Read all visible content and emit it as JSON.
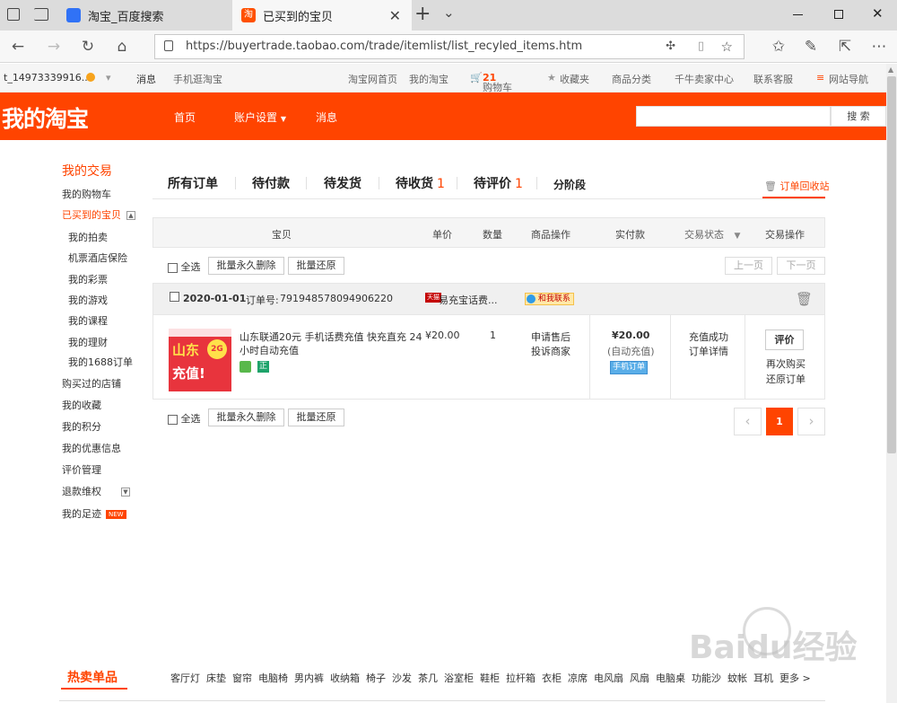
{
  "browser": {
    "tabs": [
      {
        "title": "淘宝_百度搜索",
        "icon": "baidu-paw"
      },
      {
        "title": "已买到的宝贝",
        "icon": "taobao"
      }
    ],
    "new_tab": "+",
    "url": "https://buyertrade.taobao.com/trade/itemlist/list_recyled_items.htm"
  },
  "site_nav": {
    "user": "t_14973339916...",
    "messages": "消息",
    "mobile": "手机逛淘宝",
    "home": "淘宝网首页",
    "my_taobao": "我的淘宝",
    "cart": "购物车",
    "cart_count": "21",
    "favorites": "收藏夹",
    "categories": "商品分类",
    "seller_center": "千牛卖家中心",
    "service": "联系客服",
    "site_map": "网站导航"
  },
  "header": {
    "logo": "我的淘宝",
    "nav": [
      "首页",
      "账户设置",
      "消息"
    ],
    "search_button": "搜 索",
    "search_value": ""
  },
  "sidebar": {
    "title": "我的交易",
    "items": [
      {
        "label": "我的购物车"
      },
      {
        "label": "已买到的宝贝",
        "active": true
      },
      {
        "label": "我的拍卖",
        "sub": true
      },
      {
        "label": "机票酒店保险",
        "sub": true
      },
      {
        "label": "我的彩票",
        "sub": true
      },
      {
        "label": "我的游戏",
        "sub": true
      },
      {
        "label": "我的课程",
        "sub": true
      },
      {
        "label": "我的理财",
        "sub": true
      },
      {
        "label": "我的1688订单",
        "sub": true
      },
      {
        "label": "购买过的店铺"
      },
      {
        "label": "我的收藏"
      },
      {
        "label": "我的积分"
      },
      {
        "label": "我的优惠信息"
      },
      {
        "label": "评价管理"
      },
      {
        "label": "退款维权"
      },
      {
        "label": "我的足迹",
        "badge": "NEW"
      }
    ]
  },
  "order_tabs": [
    {
      "label": "所有订单",
      "count": ""
    },
    {
      "label": "待付款",
      "count": ""
    },
    {
      "label": "待发货",
      "count": ""
    },
    {
      "label": "待收货",
      "count": "1"
    },
    {
      "label": "待评价",
      "count": "1"
    },
    {
      "label": "分阶段",
      "count": ""
    }
  ],
  "recycle_bin": "订单回收站",
  "table_headers": [
    "宝贝",
    "单价",
    "数量",
    "商品操作",
    "实付款",
    "交易状态",
    "交易操作"
  ],
  "bulk": {
    "select_all": "全选",
    "delete_forever": "批量永久删除",
    "restore": "批量还原",
    "prev": "上一页",
    "next": "下一页"
  },
  "order": {
    "date": "2020-01-01",
    "order_no_label": "订单号:",
    "order_no": "791948578094906220",
    "shop_badge": "天猫",
    "shop": "易充宝话费...",
    "contact": "和我联系",
    "thumb_text_1": "山东",
    "thumb_text_2": "充值!",
    "thumb_badge": "2G",
    "title_line1": "山东联通20元 手机话费充值 快充直充 24",
    "title_line2": "小时自动充值",
    "tag_zheng": "正",
    "price": "¥20.00",
    "qty": "1",
    "op1": "申请售后",
    "op2": "投诉商家",
    "paid": "¥20.00",
    "paid_note": "(自动充值)",
    "mobile_order": "手机订单",
    "status": "充值成功",
    "detail": "订单详情",
    "review": "评价",
    "rebuy": "再次购买",
    "restore": "还原订单"
  },
  "pager": {
    "prev": "‹",
    "current": "1",
    "next": "›"
  },
  "hot": {
    "title": "热卖单品",
    "items": [
      "客厅灯",
      "床垫",
      "窗帘",
      "电脑椅",
      "男内裤",
      "收纳箱",
      "椅子",
      "沙发",
      "茶几",
      "浴室柜",
      "鞋柜",
      "拉杆箱",
      "衣柜",
      "凉席",
      "电风扇",
      "风扇",
      "电脑桌",
      "功能沙",
      "蚊帐",
      "耳机"
    ],
    "more": "更多 >"
  },
  "watermark": "Baidu经验",
  "colors": {
    "accent": "#ff4400",
    "chrome": "#dcdcdc"
  }
}
